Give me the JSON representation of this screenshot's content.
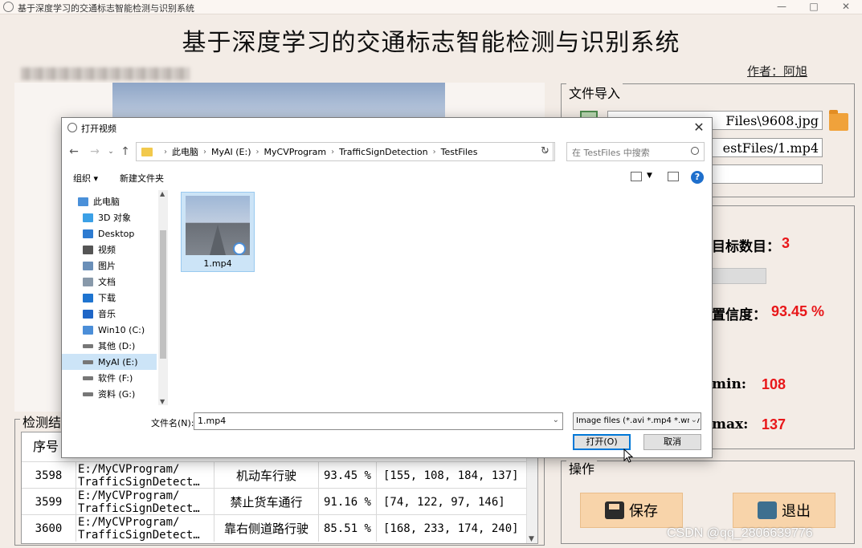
{
  "window": {
    "title": "基于深度学习的交通标志智能检测与识别系统",
    "controls": [
      "—",
      "□",
      "✕"
    ]
  },
  "app": {
    "heading": "基于深度学习的交通标志智能检测与识别系统",
    "author": "作者：阿旭"
  },
  "file_import": {
    "title": "文件导入",
    "image_path": "Files\\9608.jpg",
    "video_path": "estFiles/1.mp4",
    "camera_path": ""
  },
  "detection_info": {
    "target_count_label": "目标数目：",
    "target_count": "3",
    "confidence_label": "置信度：",
    "confidence": "93.45 %",
    "xmin_label": "min:",
    "xmin": "108",
    "xmax_label": "max:",
    "xmax": "137"
  },
  "actions": {
    "title": "操作",
    "save_label": "保存",
    "exit_label": "退出"
  },
  "results": {
    "title": "检测结",
    "header_index": "序号",
    "rows": [
      {
        "index": "3598",
        "path": "E:/MyCVProgram/\nTrafficSignDetect…",
        "name": "机动车行驶",
        "conf": "93.45 %",
        "box": "[155, 108, 184, 137]"
      },
      {
        "index": "3599",
        "path": "E:/MyCVProgram/\nTrafficSignDetect…",
        "name": "禁止货车通行",
        "conf": "91.16 %",
        "box": "[74, 122, 97, 146]"
      },
      {
        "index": "3600",
        "path": "E:/MyCVProgram/\nTrafficSignDetect…",
        "name": "靠右侧道路行驶",
        "conf": "85.51 %",
        "box": "[168, 233, 174, 240]"
      }
    ]
  },
  "watermark": "CSDN @qq_2806639776",
  "dialog": {
    "title": "打开视频",
    "breadcrumb": [
      "此电脑",
      "MyAI (E:)",
      "MyCVProgram",
      "TrafficSignDetection",
      "TestFiles"
    ],
    "search_placeholder": "在 TestFiles 中搜索",
    "organize_label": "组织 ▾",
    "new_folder_label": "新建文件夹",
    "help": "?",
    "nav_items": [
      {
        "label": "此电脑",
        "icon": "computer-icon",
        "color": "#4a90d9"
      },
      {
        "label": "3D 对象",
        "icon": "cube-icon",
        "color": "#3ba0e6"
      },
      {
        "label": "Desktop",
        "icon": "desktop-icon",
        "color": "#2d7bd1"
      },
      {
        "label": "视频",
        "icon": "video-icon",
        "color": "#555555"
      },
      {
        "label": "图片",
        "icon": "picture-icon",
        "color": "#6a8fb8"
      },
      {
        "label": "文档",
        "icon": "document-icon",
        "color": "#8899aa"
      },
      {
        "label": "下载",
        "icon": "download-icon",
        "color": "#1e74d0"
      },
      {
        "label": "音乐",
        "icon": "music-icon",
        "color": "#1f66c7"
      },
      {
        "label": "Win10 (C:)",
        "icon": "windows-drive-icon",
        "color": "#4b8ed8"
      },
      {
        "label": "其他 (D:)",
        "icon": "drive-icon",
        "color": "#777777"
      },
      {
        "label": "MyAI (E:)",
        "icon": "drive-icon",
        "color": "#777777",
        "selected": true
      },
      {
        "label": "软件 (F:)",
        "icon": "drive-icon",
        "color": "#777777"
      },
      {
        "label": "资料 (G:)",
        "icon": "drive-icon",
        "color": "#777777"
      }
    ],
    "files": [
      {
        "name": "1.mp4"
      }
    ],
    "filename_label": "文件名(N):",
    "filename_value": "1.mp4",
    "filter_value": "Image files (*.avi *.mp4 *.wmv",
    "open_label": "打开(O)",
    "cancel_label": "取消"
  }
}
